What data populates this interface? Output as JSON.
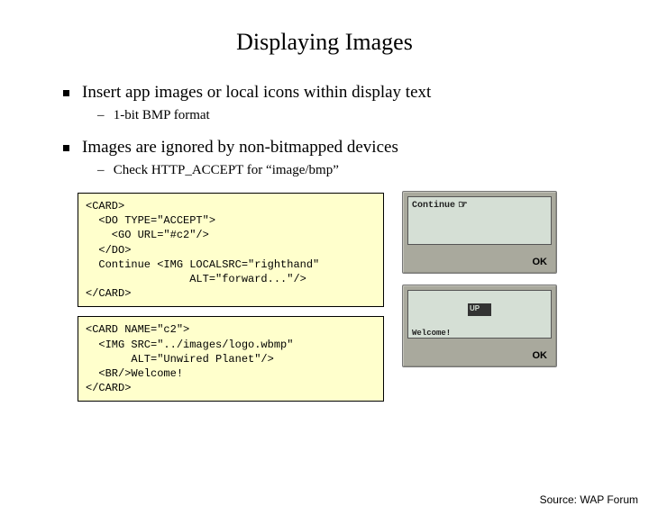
{
  "title": "Displaying Images",
  "bullets": [
    {
      "text": "Insert app images or local icons within display text",
      "sub": "1-bit BMP format"
    },
    {
      "text": "Images are ignored by non-bitmapped devices",
      "sub": "Check HTTP_ACCEPT for “image/bmp”"
    }
  ],
  "code1": "<CARD>\n  <DO TYPE=\"ACCEPT\">\n    <GO URL=\"#c2\"/>\n  </DO>\n  Continue <IMG LOCALSRC=\"righthand\"\n                ALT=\"forward...\"/>\n</CARD>",
  "code2": "<CARD NAME=\"c2\">\n  <IMG SRC=\"../images/logo.wbmp\"\n       ALT=\"Unwired Planet\"/>\n  <BR/>Welcome!\n</CARD>",
  "phone1": {
    "line1": "Continue",
    "ok": "OK"
  },
  "phone2": {
    "logo_text": "UP",
    "welcome": "Welcome!",
    "ok": "OK"
  },
  "attribution": "Source: WAP Forum"
}
